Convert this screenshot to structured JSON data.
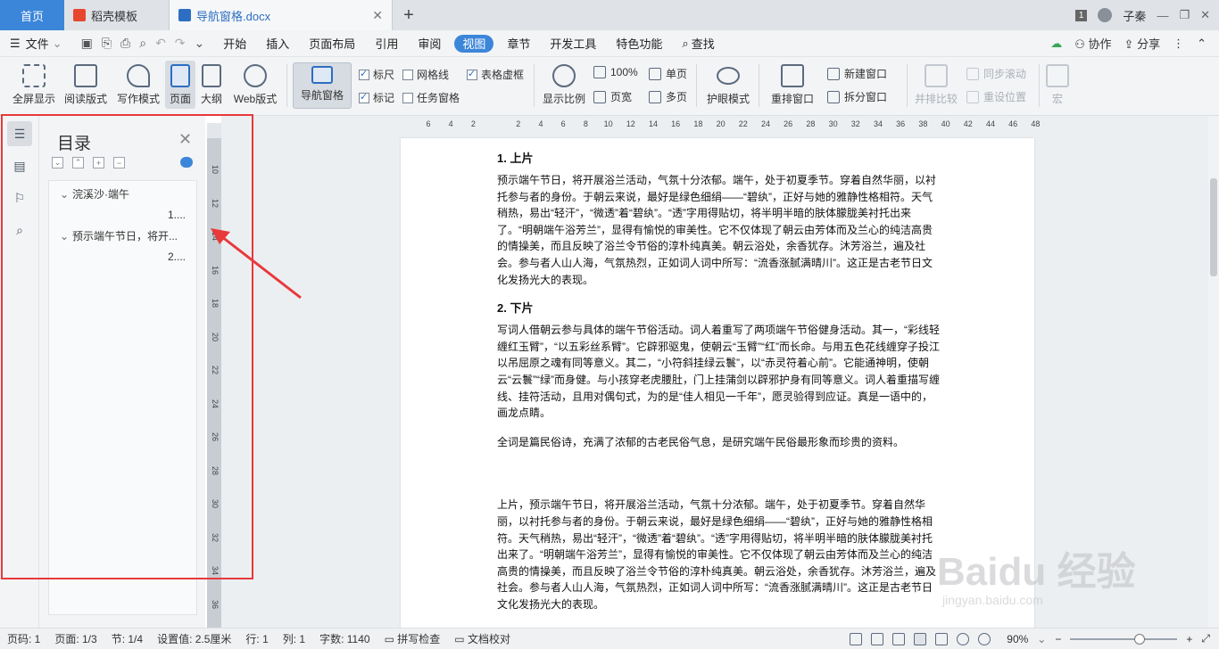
{
  "tabs": {
    "home": "首页",
    "template": "稻壳模板",
    "doc": "导航窗格.docx",
    "user": "子秦",
    "badge": "1"
  },
  "menu": {
    "file": "文件",
    "items": [
      "开始",
      "插入",
      "页面布局",
      "引用",
      "审阅",
      "视图",
      "章节",
      "开发工具",
      "特色功能",
      "查找"
    ],
    "collab": "协作",
    "share": "分享"
  },
  "ribbon": {
    "fullscreen": "全屏显示",
    "read": "阅读版式",
    "write": "写作模式",
    "page": "页面",
    "outline": "大纲",
    "web": "Web版式",
    "navpane": "导航窗格",
    "ruler": "标尺",
    "grid": "网格线",
    "table_dash": "表格虚框",
    "mark": "标记",
    "task_pane": "任务窗格",
    "zoom": "显示比例",
    "pct100": "100%",
    "single": "单页",
    "pagewidth": "页宽",
    "multi": "多页",
    "eye": "护眼模式",
    "rearrange": "重排窗口",
    "newwin": "新建窗口",
    "split": "拆分窗口",
    "sidebyside": "并排比较",
    "syncscroll": "同步滚动",
    "resetpos": "重设位置",
    "macro": "宏"
  },
  "nav": {
    "title": "目录",
    "items": [
      {
        "title": "浣溪沙·端午",
        "page": "1...."
      },
      {
        "title": "预示端午节日，将开...",
        "page": "2...."
      }
    ]
  },
  "ruler": {
    "h": [
      "6",
      "4",
      "2",
      "",
      "2",
      "4",
      "6",
      "8",
      "10",
      "12",
      "14",
      "16",
      "18",
      "20",
      "22",
      "24",
      "26",
      "28",
      "30",
      "32",
      "34",
      "36",
      "38",
      "40",
      "42",
      "44",
      "46",
      "48"
    ],
    "v": [
      "10",
      "12",
      "14",
      "16",
      "18",
      "20",
      "22",
      "24",
      "26",
      "28",
      "30",
      "32",
      "34",
      "36"
    ]
  },
  "doc": {
    "h1": "1. 上片",
    "p1": "预示端午节日，将开展浴兰活动，气氛十分浓郁。端午，处于初夏季节。穿着自然华丽，以衬托参与者的身份。于朝云来说，最好是绿色细绢——“碧纨”，正好与她的雅静性格相符。天气稍热，易出“轻汗”，“微透”着“碧纨”。“透”字用得贴切，将半明半暗的肤体朦胧美衬托出来了。“明朝端午浴芳兰”，显得有愉悦的审美性。它不仅体现了朝云由芳体而及兰心的纯洁高贵的情操美，而且反映了浴兰令节俗的淳朴纯真美。朝云浴处，余香犹存。沐芳浴兰，遍及社会。参与者人山人海，气氛热烈，正如词人词中所写：“流香涨腻满晴川”。这正是古老节日文化发扬光大的表现。",
    "h2": "2. 下片",
    "p2": "写词人借朝云参与具体的端午节俗活动。词人着重写了两项端午节俗健身活动。其一，“彩线轻缠红玉臂”，“以五彩丝系臂”。它辟邪驱鬼，使朝云“玉臂”“红”而长命。与用五色花线缠穿子投江以吊屈原之魂有同等意义。其二，“小符斜挂绿云鬟”，以“赤灵符着心前”。它能通神明，使朝云“云鬟”“绿”而身健。与小孩穿老虎腰肚，门上挂蒲剑以辟邪护身有同等意义。词人着重描写缠线、挂符活动，且用对偶句式，为的是“佳人相见一千年”，愿灵验得到应证。真是一语中的，画龙点睛。",
    "p3": "全词是篇民俗诗，充满了浓郁的古老民俗气息，是研究端午民俗最形象而珍贵的资料。",
    "p4": "上片，预示端午节日，将开展浴兰活动，气氛十分浓郁。端午，处于初夏季节。穿着自然华丽，以衬托参与者的身份。于朝云来说，最好是绿色细绢——“碧纨”，正好与她的雅静性格相符。天气稍热，易出“轻汗”，“微透”着“碧纨”。“透”字用得贴切，将半明半暗的肤体朦胧美衬托出来了。“明朝端午浴芳兰”，显得有愉悦的审美性。它不仅体现了朝云由芳体而及兰心的纯洁高贵的情操美，而且反映了浴兰令节俗的淳朴纯真美。朝云浴处，余香犹存。沐芳浴兰，遍及社会。参与者人山人海，气氛热烈，正如词人词中所写：“流香涨腻满晴川”。这正是古老节日文化发扬光大的表现。"
  },
  "status": {
    "pagenum": "页码: 1",
    "pages": "页面: 1/3",
    "section": "节: 1/4",
    "setting": "设置值: 2.5厘米",
    "row": "行: 1",
    "col": "列: 1",
    "words": "字数: 1140",
    "spell": "拼写检查",
    "proof": "文档校对",
    "zoom": "90%",
    "zoom_level": 0.66
  },
  "watermark": {
    "main": "Baidu 经验",
    "sub": "jingyan.baidu.com"
  },
  "colors": {
    "accent": "#3b86d9",
    "highlight": "#e8393b"
  }
}
